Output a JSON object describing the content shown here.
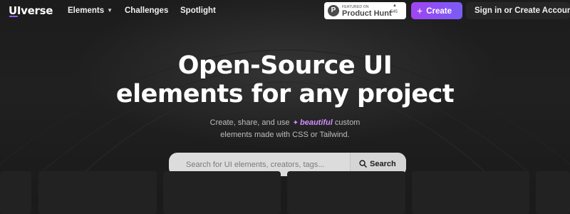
{
  "header": {
    "logo_prefix": "UI",
    "logo_suffix": "verse",
    "nav": {
      "elements_label": "Elements",
      "challenges_label": "Challenges",
      "spotlight_label": "Spotlight"
    },
    "product_hunt": {
      "featured_label": "FEATURED ON",
      "name": "Product Hunt",
      "logo_letter": "P",
      "upvote_count": "545"
    },
    "create_label": "Create",
    "signin_label": "Sign in or Create Account"
  },
  "hero": {
    "title_line1": "Open-Source UI",
    "title_line2": "elements for any project",
    "subtitle_before": "Create, share, and use",
    "subtitle_highlight": "beautiful",
    "subtitle_after": "custom",
    "subtitle_line2": "elements made with CSS or Tailwind."
  },
  "search": {
    "placeholder": "Search for UI elements, creators, tags...",
    "button_label": "Search"
  },
  "colors": {
    "background": "#1b1b1b",
    "accent_purple": "#8b5cf6",
    "create_gradient_start": "#9f45f1",
    "highlight_pink": "#d38cff",
    "search_background": "#dcdcdc"
  },
  "icons": {
    "chevron": "chevron-down-icon",
    "plus": "plus-icon",
    "sparkle": "sparkle-icon",
    "search": "search-icon",
    "upvote": "triangle-up-icon"
  }
}
